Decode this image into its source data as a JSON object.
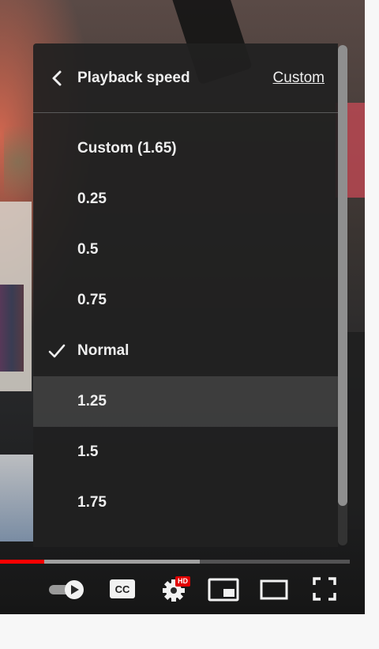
{
  "menu": {
    "title": "Playback speed",
    "custom_link": "Custom",
    "selected": "Normal",
    "items": [
      {
        "label": "Custom (1.65)",
        "checked": false
      },
      {
        "label": "0.25",
        "checked": false
      },
      {
        "label": "0.5",
        "checked": false
      },
      {
        "label": "0.75",
        "checked": false
      },
      {
        "label": "Normal",
        "checked": true
      },
      {
        "label": "1.25",
        "checked": false,
        "hovered": true
      },
      {
        "label": "1.5",
        "checked": false
      },
      {
        "label": "1.75",
        "checked": false
      }
    ]
  },
  "player": {
    "progress_played_fraction": 0.126,
    "progress_buffered_fraction": 0.57,
    "hd_badge": "HD",
    "icons": [
      "autoplay-toggle-icon",
      "cc-icon",
      "settings-gear-icon",
      "miniplayer-icon",
      "theater-mode-icon",
      "fullscreen-icon"
    ]
  },
  "colors": {
    "progress_played": "#ff0000",
    "hd_badge": "#e10000",
    "menu_text": "#eeeeee"
  }
}
